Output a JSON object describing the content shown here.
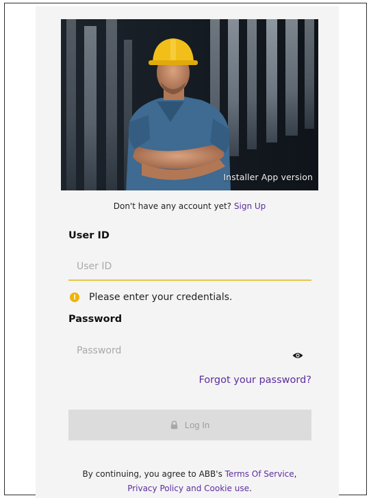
{
  "hero": {
    "caption": "Installer App version"
  },
  "signup": {
    "prompt": "Don't have any account yet? ",
    "link": "Sign Up"
  },
  "user_id": {
    "label": "User ID",
    "placeholder": "User ID",
    "value": ""
  },
  "validation": {
    "icon": "warning-icon",
    "message": "Please enter your credentials."
  },
  "password": {
    "label": "Password",
    "placeholder": "Password",
    "value": "",
    "toggle_icon": "eye-icon"
  },
  "forgot": {
    "label": "Forgot your password?"
  },
  "login": {
    "label": "Log In",
    "icon": "lock-icon",
    "enabled": false
  },
  "terms": {
    "prefix": "By continuing, you agree to ABB's ",
    "tos": "Terms Of Service",
    "comma": ",",
    "privacy": "Privacy Policy and Cookie use",
    "period": "."
  },
  "colors": {
    "accent_link": "#5b2d9e",
    "warning": "#f0b400",
    "focus_underline": "#e8c547",
    "button_disabled_bg": "#dcdcdc"
  }
}
